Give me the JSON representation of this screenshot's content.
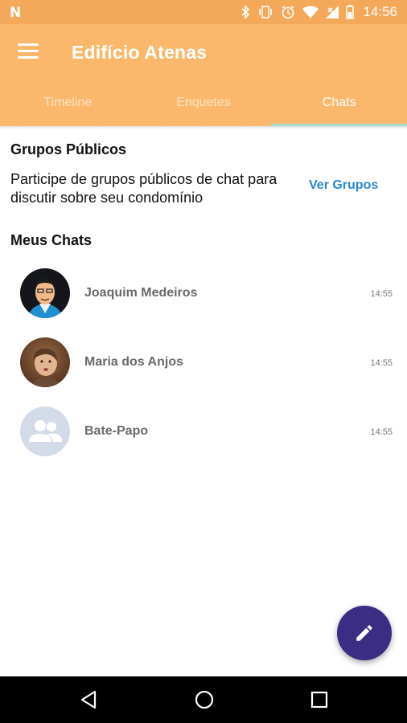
{
  "status_bar": {
    "left_icon": "n-notification-icon",
    "icons": [
      "bluetooth-icon",
      "vibrate-icon",
      "alarm-icon",
      "wifi-icon",
      "signal-icon",
      "battery-icon"
    ],
    "time": "14:56"
  },
  "app_bar": {
    "title": "Edifício Atenas",
    "background": "#fbb86c"
  },
  "tabs": [
    {
      "label": "Timeline",
      "active": false
    },
    {
      "label": "Enquetes",
      "active": false
    },
    {
      "label": "Chats",
      "active": true
    }
  ],
  "public_groups": {
    "title": "Grupos Públicos",
    "description": "Participe de grupos públicos de chat para discutir sobre seu condomínio",
    "action_label": "Ver Grupos"
  },
  "my_chats": {
    "title": "Meus Chats",
    "items": [
      {
        "name": "Joaquim Medeiros",
        "time": "14:55",
        "avatar": "illustrated-man-avatar"
      },
      {
        "name": "Maria dos Anjos",
        "time": "14:55",
        "avatar": "photo-woman-avatar"
      },
      {
        "name": "Bate-Papo",
        "time": "14:55",
        "avatar": "group-icon"
      }
    ]
  },
  "fab": {
    "icon": "pencil-icon",
    "color": "#3b2c84"
  },
  "nav_bar": {
    "buttons": [
      "back-icon",
      "home-icon",
      "recents-icon"
    ]
  }
}
